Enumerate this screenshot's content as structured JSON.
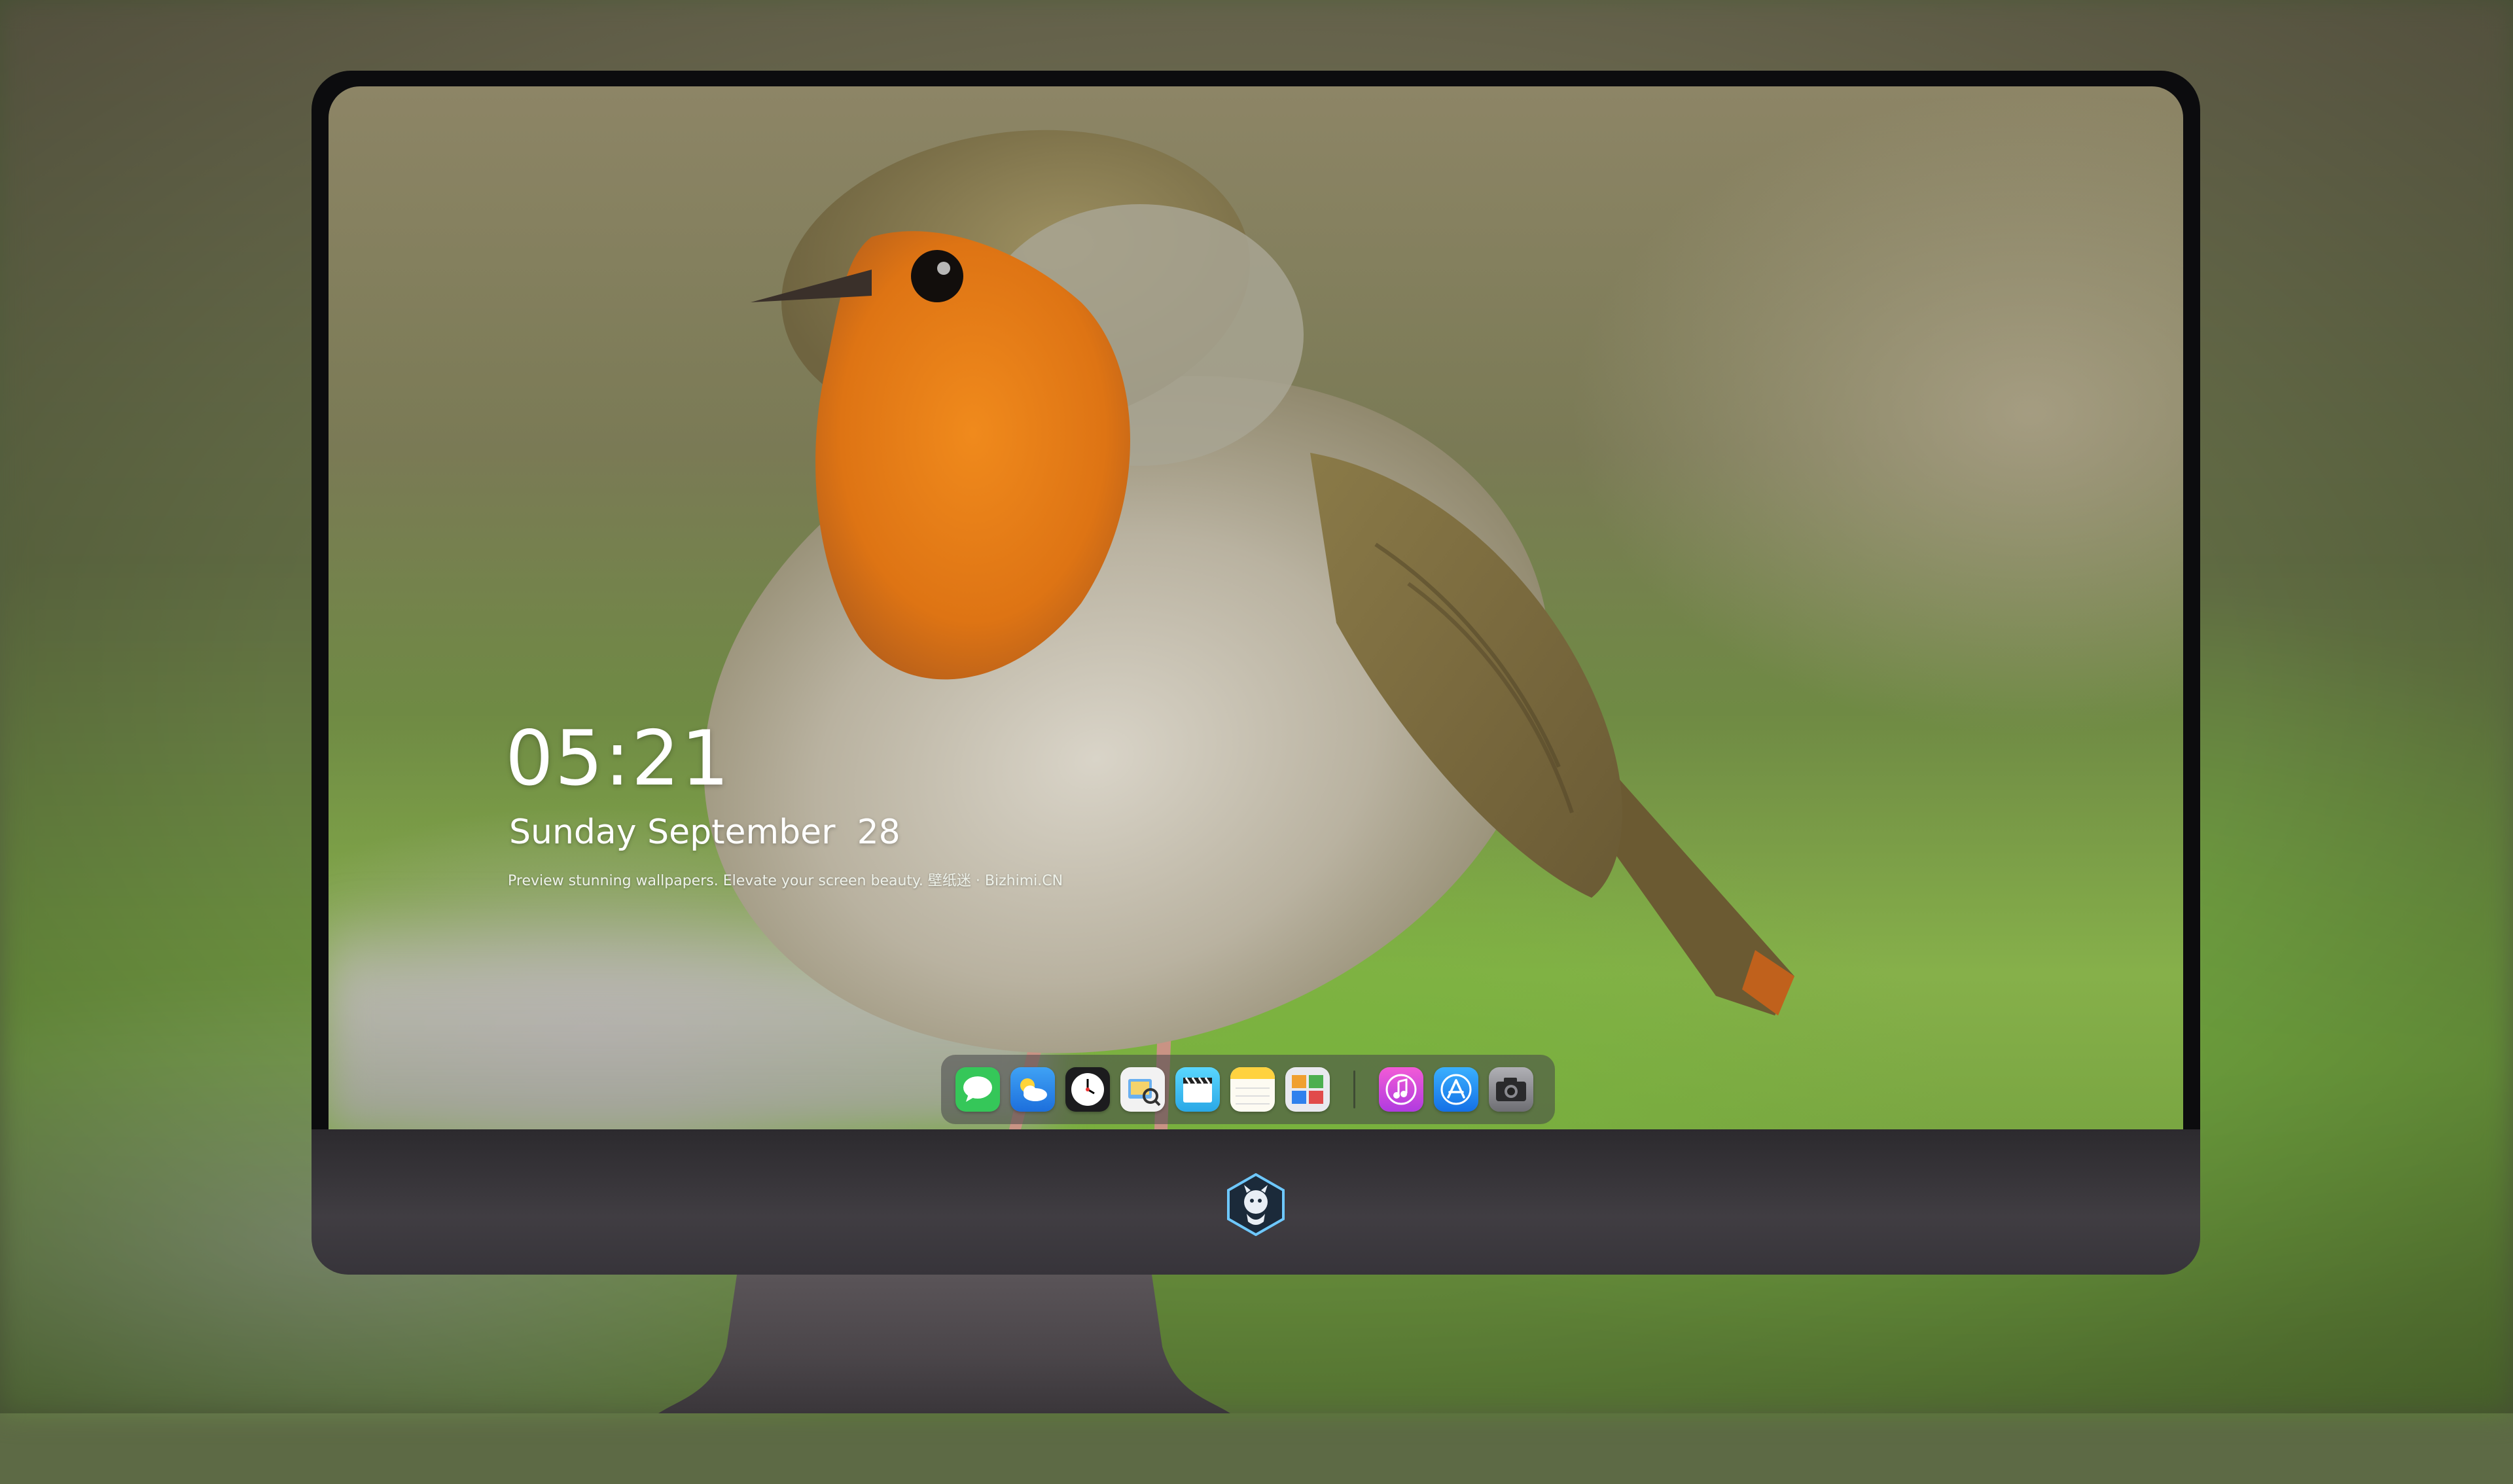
{
  "lockscreen": {
    "time": "05:21",
    "date": "Sunday September  28",
    "tagline": "Preview stunning wallpapers. Elevate your screen beauty. 壁纸迷 · Bizhimi.CN"
  },
  "dock": {
    "left_apps": [
      {
        "name": "messages-icon",
        "color": "#35c759"
      },
      {
        "name": "weather-icon",
        "color": "#2f8ef0"
      },
      {
        "name": "clock-icon",
        "color": "#1c1c1e"
      },
      {
        "name": "preview-icon",
        "color": "#f2f2f2"
      },
      {
        "name": "clips-icon",
        "color": "#3fc7f0"
      },
      {
        "name": "notes-icon",
        "color": "#ffd23f"
      },
      {
        "name": "photo-booth-icon",
        "color": "#e9e9ef"
      }
    ],
    "right_apps": [
      {
        "name": "itunes-icon",
        "color": "#e04cc8"
      },
      {
        "name": "app-store-icon",
        "color": "#1e8ef5"
      },
      {
        "name": "camera-icon",
        "color": "#8e8e93"
      }
    ]
  },
  "colors": {
    "bezel": "#0c0c0e",
    "chin": "#3a373c",
    "stand": "#4a4649"
  }
}
